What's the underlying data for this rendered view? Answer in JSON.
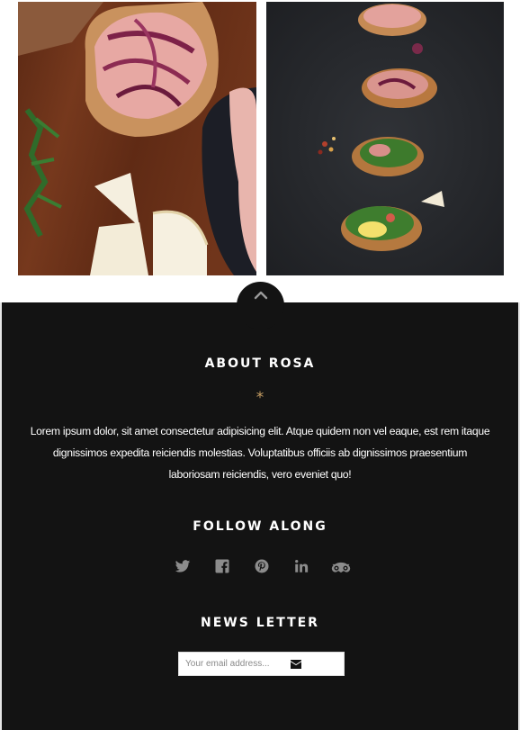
{
  "gallery": {
    "images": [
      {
        "icon": "charcuterie-board-photo",
        "alt": "bruschetta with prosciutto, red onion, arugula and brie on wooden board"
      },
      {
        "icon": "bruschetta-row-photo",
        "alt": "four bruschetta toasts on dark slate"
      }
    ]
  },
  "back_to_top": {
    "icon": "chevron-up-icon"
  },
  "about": {
    "title": "ABOUT ROSA",
    "ornament": "*",
    "text": "Lorem ipsum dolor, sit amet consectetur adipisicing elit. Atque quidem non vel eaque, est rem itaque dignissimos expedita reiciendis molestias. Voluptatibus officiis ab dignissimos praesentium laboriosam reiciendis, vero eveniet quo!"
  },
  "follow": {
    "title": "FOLLOW ALONG",
    "icons": [
      "twitter-icon",
      "facebook-icon",
      "pinterest-icon",
      "linkedin-icon",
      "tripadvisor-icon"
    ]
  },
  "newsletter": {
    "title": "NEWS LETTER",
    "placeholder": "Your email address...",
    "value": "",
    "submit_icon": "envelope-icon"
  },
  "colors": {
    "footer_bg": "#131313",
    "accent": "#c9a064",
    "icon_gray": "#8c8c8c",
    "text": "#ffffff"
  }
}
